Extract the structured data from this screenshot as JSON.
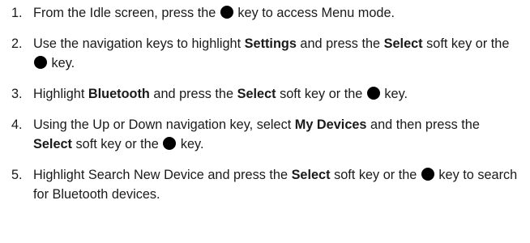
{
  "steps": [
    {
      "number": "1.",
      "parts": [
        {
          "type": "text",
          "text": "From the Idle screen, press the "
        },
        {
          "type": "icon",
          "icon": "select-key-dot-icon"
        },
        {
          "type": "text",
          "text": " key to access Menu mode."
        }
      ]
    },
    {
      "number": "2.",
      "parts": [
        {
          "type": "text",
          "text": "Use the navigation keys to highlight "
        },
        {
          "type": "bold",
          "text": "Settings"
        },
        {
          "type": "text",
          "text": " and press the "
        },
        {
          "type": "bold",
          "text": "Select"
        },
        {
          "type": "text",
          "text": " soft key or the "
        },
        {
          "type": "icon",
          "icon": "select-key-dot-icon"
        },
        {
          "type": "text",
          "text": " key."
        }
      ]
    },
    {
      "number": "3.",
      "parts": [
        {
          "type": "text",
          "text": "Highlight "
        },
        {
          "type": "bold",
          "text": "Bluetooth"
        },
        {
          "type": "text",
          "text": " and press the "
        },
        {
          "type": "bold",
          "text": "Select"
        },
        {
          "type": "text",
          "text": " soft key or the "
        },
        {
          "type": "icon",
          "icon": "select-key-dot-icon"
        },
        {
          "type": "text",
          "text": " key."
        }
      ]
    },
    {
      "number": "4.",
      "parts": [
        {
          "type": "text",
          "text": "Using the Up or Down navigation key, select "
        },
        {
          "type": "bold",
          "text": "My Devices"
        },
        {
          "type": "text",
          "text": " and then press the "
        },
        {
          "type": "bold",
          "text": "Select"
        },
        {
          "type": "text",
          "text": " soft key or the "
        },
        {
          "type": "icon",
          "icon": "select-key-dot-icon"
        },
        {
          "type": "text",
          "text": " key."
        }
      ]
    },
    {
      "number": "5.",
      "parts": [
        {
          "type": "text",
          "text": "Highlight Search New Device and press the "
        },
        {
          "type": "bold",
          "text": "Select"
        },
        {
          "type": "text",
          "text": " soft key or the "
        },
        {
          "type": "icon",
          "icon": "select-key-dot-icon"
        },
        {
          "type": "text",
          "text": " key to search for Bluetooth devices."
        }
      ]
    }
  ]
}
